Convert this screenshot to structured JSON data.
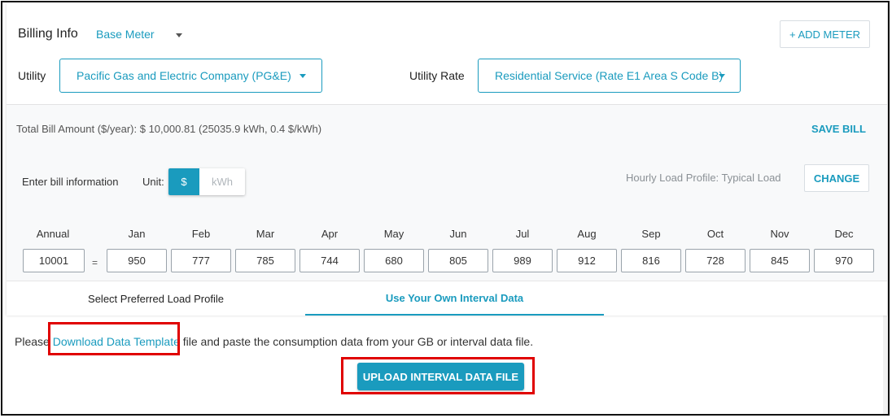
{
  "header": {
    "billing_info": "Billing Info",
    "meter_select": "Base Meter",
    "add_meter": "+ ADD METER"
  },
  "utility": {
    "label": "Utility",
    "value": "Pacific Gas and Electric Company (PG&E)"
  },
  "utility_rate": {
    "label": "Utility Rate",
    "value": "Residential Service (Rate E1 Area S Code B)"
  },
  "summary": {
    "total_bill": "Total Bill Amount ($/year): $ 10,000.81 (25035.9 kWh, 0.4 $/kWh)",
    "save_bill": "SAVE BILL"
  },
  "bill_entry": {
    "label": "Enter bill information",
    "unit_label": "Unit:",
    "unit_options": [
      "$",
      "kWh"
    ],
    "selected_unit": "$",
    "load_profile_text": "Hourly Load Profile: Typical Load",
    "change": "CHANGE"
  },
  "months": {
    "annual_label": "Annual",
    "annual_value": "10001",
    "equals": "=",
    "labels": [
      "Jan",
      "Feb",
      "Mar",
      "Apr",
      "May",
      "Jun",
      "Jul",
      "Aug",
      "Sep",
      "Oct",
      "Nov",
      "Dec"
    ],
    "values": [
      "950",
      "777",
      "785",
      "744",
      "680",
      "805",
      "989",
      "912",
      "816",
      "728",
      "845",
      "970"
    ]
  },
  "tabs": [
    {
      "label": "Select Preferred Load Profile",
      "active": false
    },
    {
      "label": "Use Your Own Interval Data",
      "active": true
    }
  ],
  "interval": {
    "text_before": "Please ",
    "link": "Download Data Template",
    "text_after": " file and paste the consumption data from your GB or interval data file.",
    "upload_button": "UPLOAD INTERVAL DATA FILE"
  },
  "colors": {
    "accent": "#1a9bbe",
    "highlight": "#e00000",
    "upload_button_bg": "#1a9bbe"
  }
}
